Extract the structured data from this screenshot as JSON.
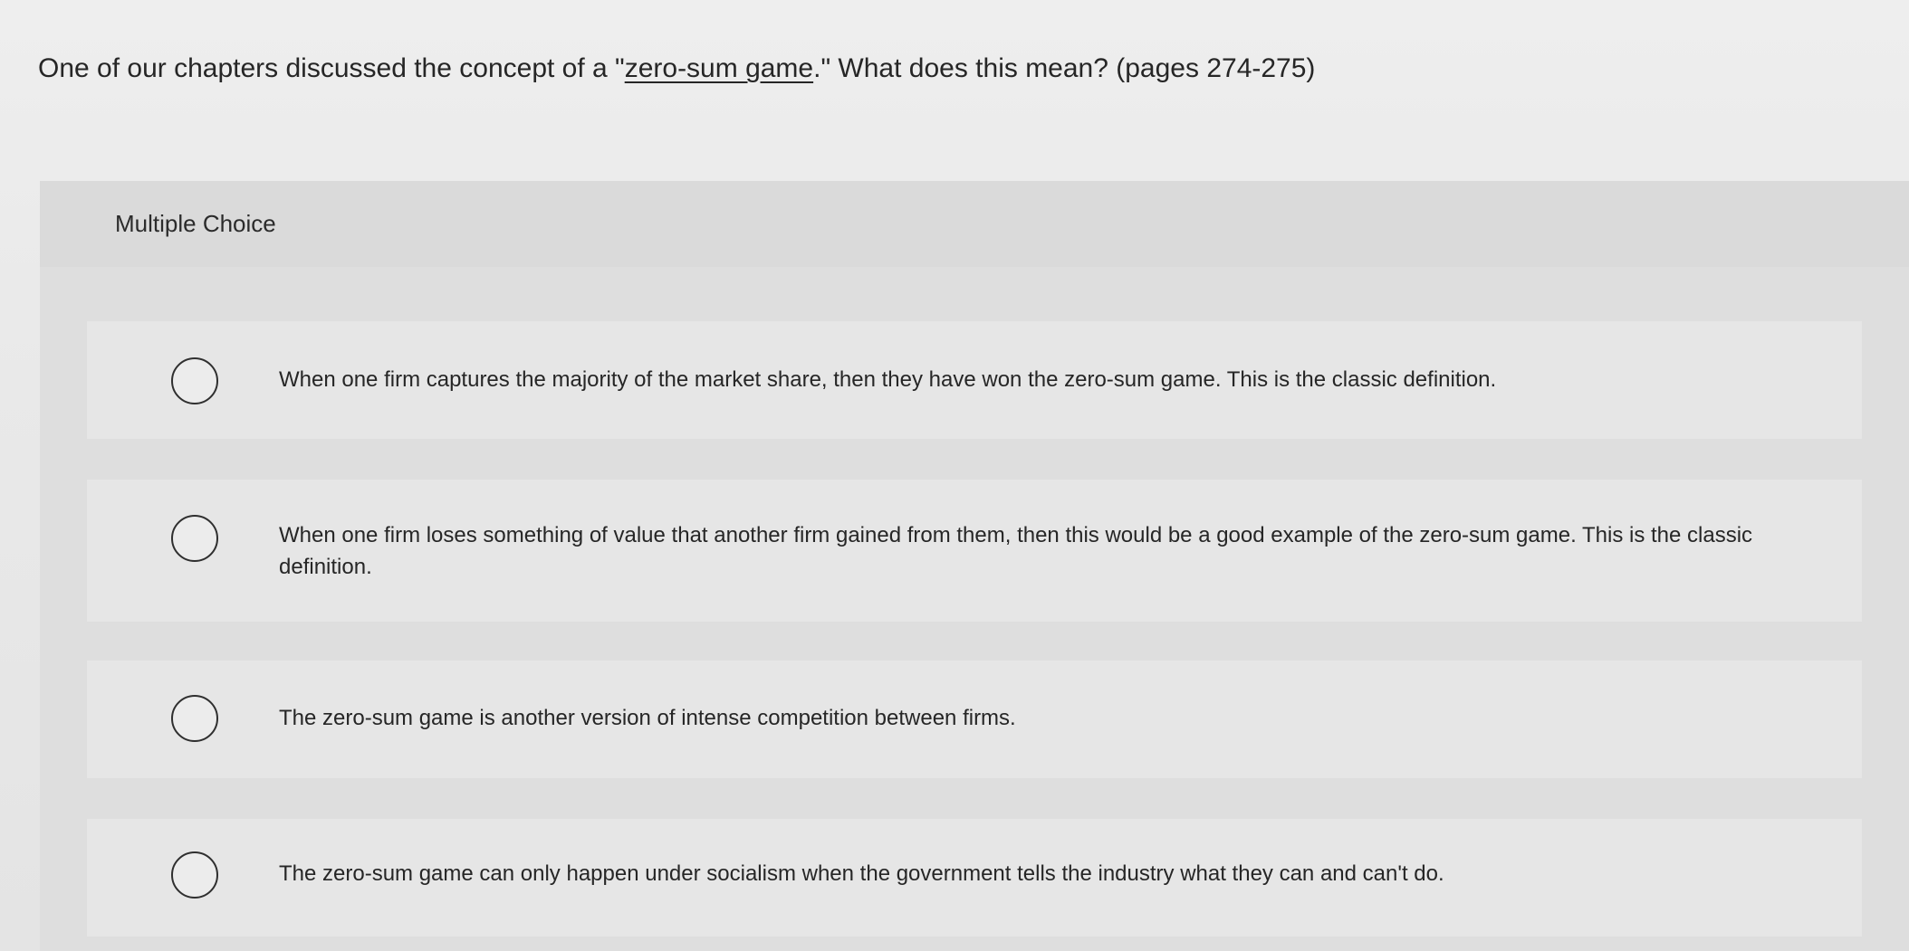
{
  "question": {
    "prefix": "One of our chapters discussed the concept of a \"",
    "term": "zero-sum game",
    "suffix": ".\" What does this mean? (pages 274-275)"
  },
  "mc_label": "Multiple Choice",
  "options": [
    {
      "text": "When one firm captures the majority of the market share, then they have won the zero-sum game. This is the classic definition.",
      "selected": false
    },
    {
      "text": "When one firm loses something of value that another firm gained from them, then this would be a good example of the zero-sum game. This is the classic definition.",
      "selected": false
    },
    {
      "text": "The zero-sum game is another version of intense competition between firms.",
      "selected": false
    },
    {
      "text": "The zero-sum game can only happen under socialism when the government tells the industry what they can and can't do.",
      "selected": false
    }
  ]
}
